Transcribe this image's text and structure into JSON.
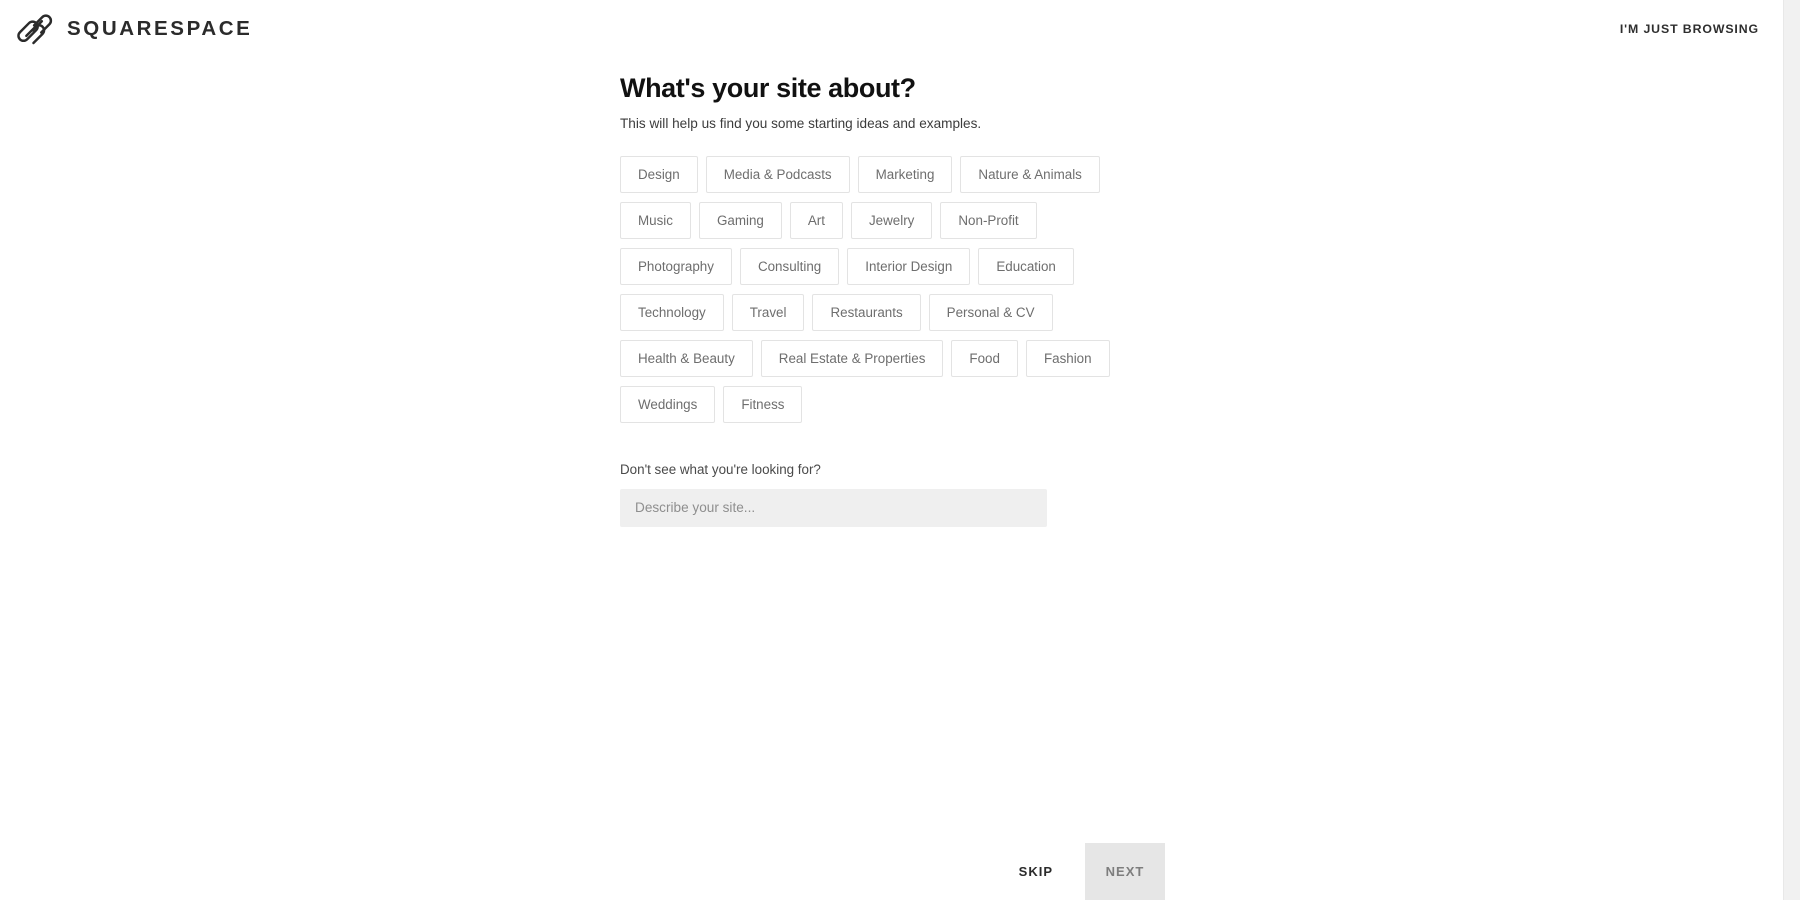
{
  "header": {
    "logo_icon": "squarespace-logo-icon",
    "brand_name": "SQUARESPACE",
    "browsing_link_label": "I'M JUST BROWSING"
  },
  "main": {
    "title": "What's your site about?",
    "subtitle": "This will help us find you some starting ideas and examples.",
    "categories": [
      "Design",
      "Media & Podcasts",
      "Marketing",
      "Nature & Animals",
      "Music",
      "Gaming",
      "Art",
      "Jewelry",
      "Non-Profit",
      "Photography",
      "Consulting",
      "Interior Design",
      "Education",
      "Technology",
      "Travel",
      "Restaurants",
      "Personal & CV",
      "Health & Beauty",
      "Real Estate & Properties",
      "Food",
      "Fashion",
      "Weddings",
      "Fitness"
    ],
    "fallback_label": "Don't see what you're looking for?",
    "describe_placeholder": "Describe your site...",
    "describe_value": ""
  },
  "footer": {
    "skip_label": "SKIP",
    "next_label": "NEXT"
  },
  "colors": {
    "page_background": "#ffffff",
    "text_primary": "#111111",
    "text_secondary": "#6e6e6e",
    "chip_border": "#e3e3e3",
    "input_background": "#efefef",
    "next_button_background": "#e6e6e6",
    "scrollbar_track": "#f1f1f1"
  }
}
